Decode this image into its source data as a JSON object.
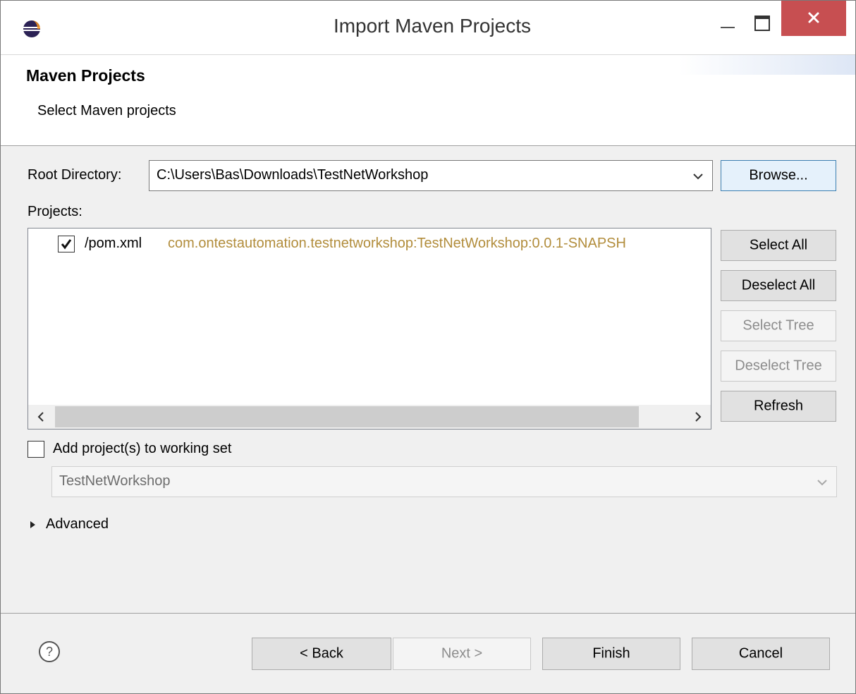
{
  "window": {
    "title": "Import Maven Projects"
  },
  "header": {
    "title": "Maven Projects",
    "subtitle": "Select Maven projects"
  },
  "root_directory": {
    "label": "Root Directory:",
    "value": "C:\\Users\\Bas\\Downloads\\TestNetWorkshop",
    "browse_label": "Browse..."
  },
  "projects": {
    "label": "Projects:",
    "items": [
      {
        "checked": true,
        "name": "/pom.xml",
        "coordinates": "com.ontestautomation.testnetworkshop:TestNetWorkshop:0.0.1-SNAPSH"
      }
    ],
    "buttons": {
      "select_all": "Select All",
      "deselect_all": "Deselect All",
      "select_tree": "Select Tree",
      "deselect_tree": "Deselect Tree",
      "refresh": "Refresh"
    }
  },
  "working_set": {
    "checkbox_label": "Add project(s) to working set",
    "checked": false,
    "value": "TestNetWorkshop"
  },
  "advanced": {
    "label": "Advanced"
  },
  "footer": {
    "back_label": "< Back",
    "next_label": "Next >",
    "finish_label": "Finish",
    "cancel_label": "Cancel"
  },
  "colors": {
    "close_button": "#c74f51",
    "default_button_border": "#3c7fb1",
    "project_coordinates": "#b28d3c"
  },
  "icons": {
    "app": "eclipse-icon",
    "help": "help-icon"
  }
}
